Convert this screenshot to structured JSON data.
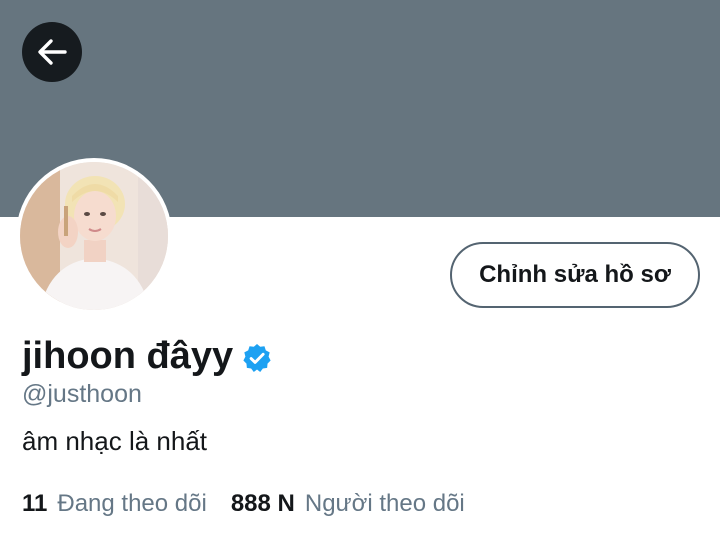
{
  "header": {
    "banner_color": "#66757f",
    "back_icon": "arrow-left-icon"
  },
  "profile": {
    "display_name": "jihoon đâyy",
    "verified": true,
    "verified_icon": "verified-badge-icon",
    "handle": "@justhoon",
    "bio": "âm nhạc là nhất",
    "edit_button_label": "Chỉnh sửa hồ sơ"
  },
  "stats": {
    "following_count": "11",
    "following_label": "Đang theo dõi",
    "followers_count": "888 N",
    "followers_label": "Người theo dõi"
  },
  "colors": {
    "accent": "#1da1f2",
    "text_primary": "#14171a",
    "text_secondary": "#657786"
  }
}
